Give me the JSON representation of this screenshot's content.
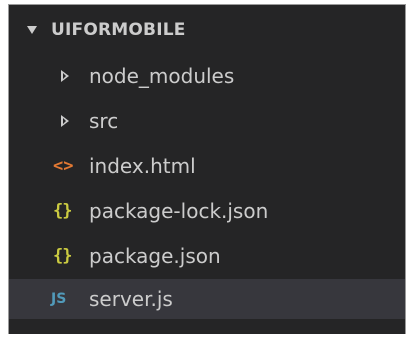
{
  "explorer": {
    "root": {
      "label": "UIFORMOBILE",
      "expanded": true,
      "icon": "chevron-down-icon"
    },
    "items": [
      {
        "label": "node_modules",
        "type": "folder",
        "expanded": false,
        "icon": "chevron-right-icon"
      },
      {
        "label": "src",
        "type": "folder",
        "expanded": false,
        "icon": "chevron-right-icon"
      },
      {
        "label": "index.html",
        "type": "file",
        "icon_glyph": "<>",
        "icon": "html-file-icon",
        "icon_color": "#e37933"
      },
      {
        "label": "package-lock.json",
        "type": "file",
        "icon_glyph": "{}",
        "icon": "json-file-icon",
        "icon_color": "#cbcb41"
      },
      {
        "label": "package.json",
        "type": "file",
        "icon_glyph": "{}",
        "icon": "json-file-icon",
        "icon_color": "#cbcb41"
      },
      {
        "label": "server.js",
        "type": "file",
        "icon_glyph": "JS",
        "icon": "js-file-icon",
        "icon_color": "#519aba",
        "selected": true
      }
    ]
  },
  "colors": {
    "background": "#252526",
    "text": "#cccccc",
    "selection": "#37373d"
  }
}
